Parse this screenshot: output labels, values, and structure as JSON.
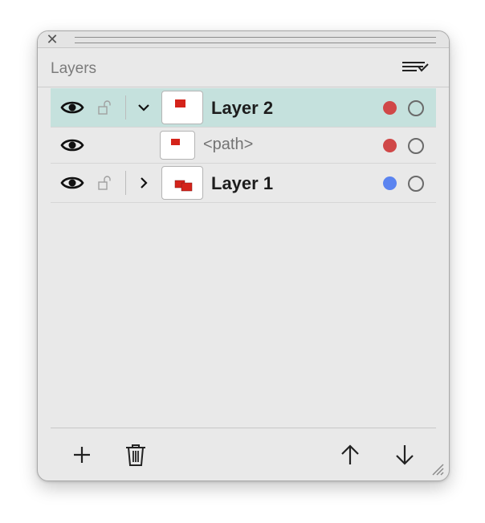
{
  "window": {
    "close_glyph": "✕"
  },
  "header": {
    "title": "Layers",
    "menu_icon": "list-check-menu-icon"
  },
  "layers": [
    {
      "name": "Layer 2",
      "visible": true,
      "locked": false,
      "expanded": true,
      "selected": true,
      "color": "#d04848"
    },
    {
      "name": "<path>",
      "visible": true,
      "child": true,
      "color": "#d04848"
    },
    {
      "name": "Layer 1",
      "visible": true,
      "locked": false,
      "expanded": false,
      "selected": false,
      "color": "#5b84f0"
    }
  ],
  "footer": {
    "add_icon": "plus-icon",
    "delete_icon": "trash-icon",
    "move_up_icon": "arrow-up-icon",
    "move_down_icon": "arrow-down-icon"
  }
}
